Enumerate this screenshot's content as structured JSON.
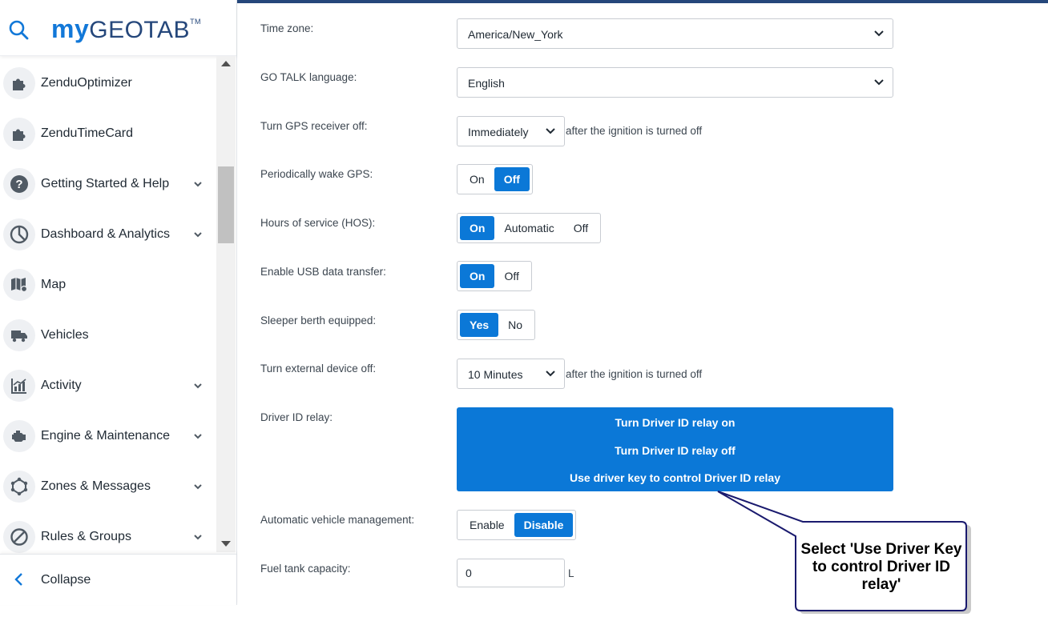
{
  "sidebar": {
    "logo": {
      "my": "my",
      "geotab": "GEOTAB",
      "tm": "TM"
    },
    "items": [
      {
        "label": "ZenduOptimizer",
        "icon": "puzzle-icon",
        "expandable": false
      },
      {
        "label": "ZenduTimeCard",
        "icon": "puzzle-icon",
        "expandable": false
      },
      {
        "label": "Getting Started & Help",
        "icon": "help-icon",
        "expandable": true
      },
      {
        "label": "Dashboard & Analytics",
        "icon": "pie-chart-icon",
        "expandable": true
      },
      {
        "label": "Map",
        "icon": "map-icon",
        "expandable": false
      },
      {
        "label": "Vehicles",
        "icon": "truck-icon",
        "expandable": false
      },
      {
        "label": "Activity",
        "icon": "activity-chart-icon",
        "expandable": true
      },
      {
        "label": "Engine & Maintenance",
        "icon": "engine-icon",
        "expandable": true
      },
      {
        "label": "Zones & Messages",
        "icon": "zones-icon",
        "expandable": true
      },
      {
        "label": "Rules & Groups",
        "icon": "rules-icon",
        "expandable": true
      }
    ],
    "collapse_label": "Collapse"
  },
  "form": {
    "time_zone": {
      "label": "Time zone:",
      "value": "America/New_York"
    },
    "go_talk": {
      "label": "GO TALK language:",
      "value": "English"
    },
    "gps_off": {
      "label": "Turn GPS receiver off:",
      "value": "Immediately",
      "suffix": "after the ignition is turned off"
    },
    "wake_gps": {
      "label": "Periodically wake GPS:",
      "options": [
        "On",
        "Off"
      ],
      "selected": "Off"
    },
    "hos": {
      "label": "Hours of service (HOS):",
      "options": [
        "On",
        "Automatic",
        "Off"
      ],
      "selected": "On"
    },
    "usb": {
      "label": "Enable USB data transfer:",
      "options": [
        "On",
        "Off"
      ],
      "selected": "On"
    },
    "sleeper": {
      "label": "Sleeper berth equipped:",
      "options": [
        "Yes",
        "No"
      ],
      "selected": "Yes"
    },
    "ext_off": {
      "label": "Turn external device off:",
      "value": "10 Minutes",
      "suffix": "after the ignition is turned off"
    },
    "relay": {
      "label": "Driver ID relay:",
      "options": [
        "Turn Driver ID relay on",
        "Turn Driver ID relay off",
        "Use driver key to control Driver ID relay"
      ]
    },
    "avm": {
      "label": "Automatic vehicle management:",
      "options": [
        "Enable",
        "Disable"
      ],
      "selected": "Disable"
    },
    "fuel": {
      "label": "Fuel tank capacity:",
      "value": "0",
      "unit": "L"
    }
  },
  "callout": {
    "text": "Select 'Use Driver Key to control Driver ID relay'"
  },
  "colors": {
    "accent": "#0b78d7",
    "brand_dark": "#25477b",
    "callout_border": "#1a1a6e"
  }
}
